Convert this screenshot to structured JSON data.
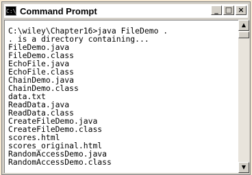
{
  "window": {
    "title": "Command Prompt",
    "icon": "command-prompt-icon",
    "icon_glyph": "C:\\",
    "controls": {
      "minimize": "_",
      "maximize": "□",
      "close": "×"
    }
  },
  "console": {
    "lines": [
      "C:\\wiley\\Chapter16>java FileDemo .",
      ". is a directory containing...",
      "FileDemo.java",
      "FileDemo.class",
      "EchoFile.java",
      "EchoFile.class",
      "ChainDemo.java",
      "ChainDemo.class",
      "data.txt",
      "ReadData.java",
      "ReadData.class",
      "CreateFileDemo.java",
      "CreateFileDemo.class",
      "scores.html",
      "scores_original.html",
      "RandomAccessDemo.java",
      "RandomAccessDemo.class"
    ]
  },
  "scrollbar": {
    "up_icon": "▲",
    "down_icon": "▼",
    "position": 0.0
  }
}
